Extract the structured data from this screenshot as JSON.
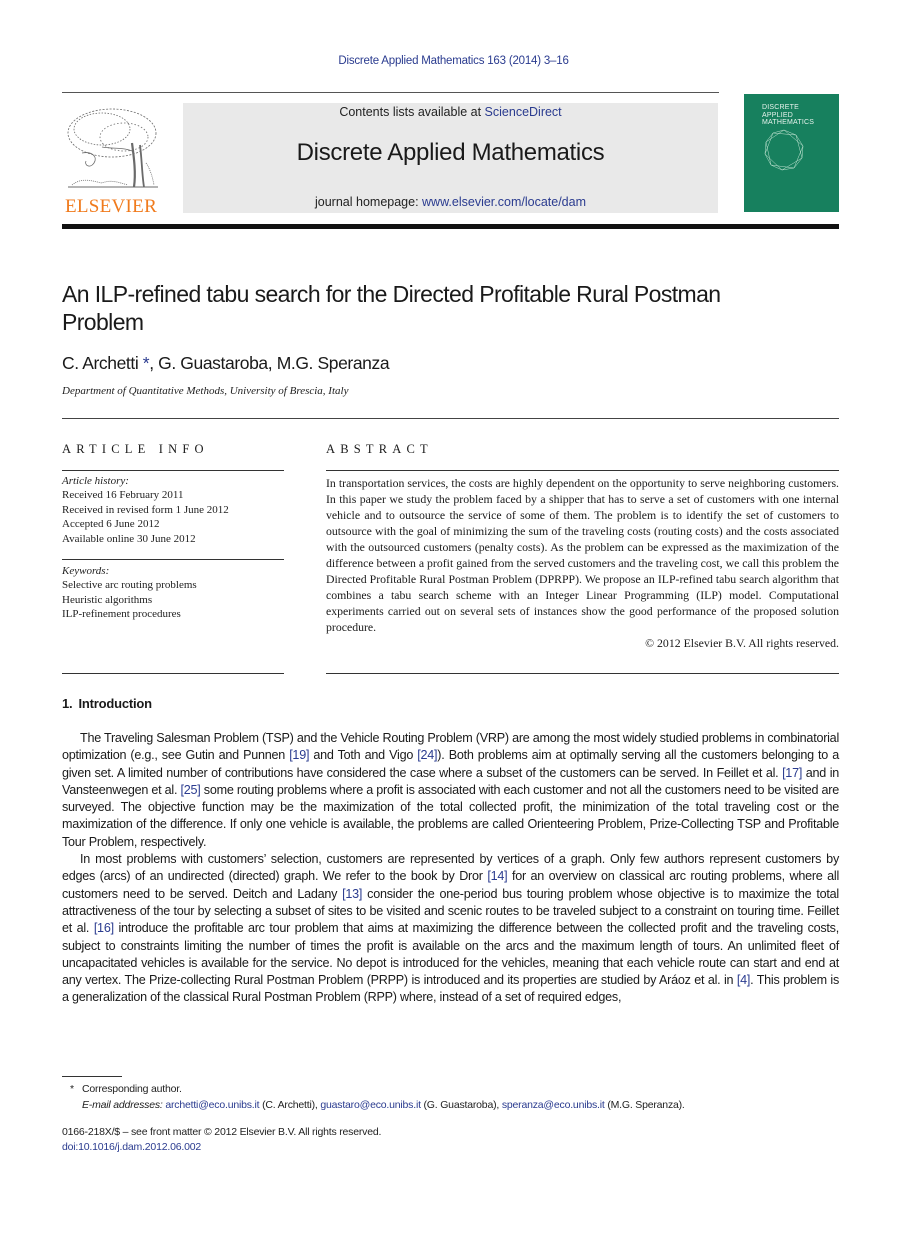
{
  "running_head": "Discrete Applied Mathematics 163 (2014) 3–16",
  "header": {
    "publisher_wordmark": "ELSEVIER",
    "contents_prefix": "Contents lists available at ",
    "contents_link": "ScienceDirect",
    "journal_title": "Discrete Applied Mathematics",
    "homepage_prefix": "journal homepage: ",
    "homepage_link": "www.elsevier.com/locate/dam",
    "cover": {
      "title_lines": [
        "DISCRETE",
        "APPLIED",
        "MATHEMATICS"
      ],
      "color": "#17805e"
    }
  },
  "article": {
    "title": "An ILP-refined tabu search for the Directed Profitable Rural Postman Problem",
    "authors": [
      {
        "name": "C. Archetti",
        "mark": "*"
      },
      {
        "name": "G. Guastaroba",
        "mark": ""
      },
      {
        "name": "M.G. Speranza",
        "mark": ""
      }
    ],
    "affiliation": "Department of Quantitative Methods, University of Brescia, Italy"
  },
  "article_info": {
    "heading": "ARTICLE INFO",
    "history_label": "Article history:",
    "history": [
      "Received 16 February 2011",
      "Received in revised form 1 June 2012",
      "Accepted 6 June 2012",
      "Available online 30 June 2012"
    ],
    "keywords_label": "Keywords:",
    "keywords": [
      "Selective arc routing problems",
      "Heuristic algorithms",
      "ILP-refinement procedures"
    ]
  },
  "abstract": {
    "heading": "ABSTRACT",
    "text": "In transportation services, the costs are highly dependent on the opportunity to serve neighboring customers. In this paper we study the problem faced by a shipper that has to serve a set of customers with one internal vehicle and to outsource the service of some of them. The problem is to identify the set of customers to outsource with the goal of minimizing the sum of the traveling costs (routing costs) and the costs associated with the outsourced customers (penalty costs). As the problem can be expressed as the maximization of the difference between a profit gained from the served customers and the traveling cost, we call this problem the Directed Profitable Rural Postman Problem (DPRPP). We propose an ILP-refined tabu search algorithm that combines a tabu search scheme with an Integer Linear Programming (ILP) model. Computational experiments carried out on several sets of instances show the good performance of the proposed solution procedure.",
    "copyright": "© 2012 Elsevier B.V. All rights reserved."
  },
  "introduction": {
    "number": "1.",
    "heading": "Introduction",
    "p1": {
      "a": "The Traveling Salesman Problem (TSP) and the Vehicle Routing Problem (VRP) are among the most widely studied problems in combinatorial optimization (e.g., see Gutin and Punnen ",
      "ref1": "[19]",
      "b": " and Toth and Vigo ",
      "ref2": "[24]",
      "c": "). Both problems aim at optimally serving all the customers belonging to a given set. A limited number of contributions have considered the case where a subset of the customers can be served. In Feillet et al. ",
      "ref3": "[17]",
      "d": " and in Vansteenwegen et al. ",
      "ref4": "[25]",
      "e": " some routing problems where a profit is associated with each customer and not all the customers need to be visited are surveyed. The objective function may be the maximization of the total collected profit, the minimization of the total traveling cost or the maximization of the difference. If only one vehicle is available, the problems are called Orienteering Problem, Prize-Collecting TSP and Profitable Tour Problem, respectively."
    },
    "p2": {
      "a": "In most problems with customers’ selection, customers are represented by vertices of a graph. Only few authors represent customers by edges (arcs) of an undirected (directed) graph. We refer to the book by Dror ",
      "ref1": "[14]",
      "b": " for an overview on classical arc routing problems, where all customers need to be served. Deitch and Ladany ",
      "ref2": "[13]",
      "c": " consider the one-period bus touring problem whose objective is to maximize the total attractiveness of the tour by selecting a subset of sites to be visited and scenic routes to be traveled subject to a constraint on touring time. Feillet et al. ",
      "ref3": "[16]",
      "d": " introduce the profitable arc tour problem that aims at maximizing the difference between the collected profit and the traveling costs, subject to constraints limiting the number of times the profit is available on the arcs and the maximum length of tours. An unlimited fleet of uncapacitated vehicles is available for the service. No depot is introduced for the vehicles, meaning that each vehicle route can start and end at any vertex. The Prize-collecting Rural Postman Problem (PRPP) is introduced and its properties are studied by Aráoz et al. in ",
      "ref4": "[4]",
      "e": ". This problem is a generalization of the classical Rural Postman Problem (RPP) where, instead of a set of required edges,"
    }
  },
  "footnotes": {
    "star": "*",
    "corresponding": "Corresponding author.",
    "email_label": "E-mail addresses:",
    "emails": [
      {
        "address": "archetti@eco.unibs.it",
        "owner": "(C. Archetti),"
      },
      {
        "address": "guastaro@eco.unibs.it",
        "owner": "(G. Guastaroba),"
      },
      {
        "address": "speranza@eco.unibs.it",
        "owner": "(M.G. Speranza)."
      }
    ]
  },
  "front_matter": {
    "issn_line": "0166-218X/$ – see front matter © 2012 Elsevier B.V. All rights reserved.",
    "doi": "doi:10.1016/j.dam.2012.06.002"
  },
  "colors": {
    "link": "#2a3b8f",
    "elsevier_orange": "#f07a1c",
    "banner_gray": "#e9e9e9",
    "cover_green": "#17805e"
  }
}
